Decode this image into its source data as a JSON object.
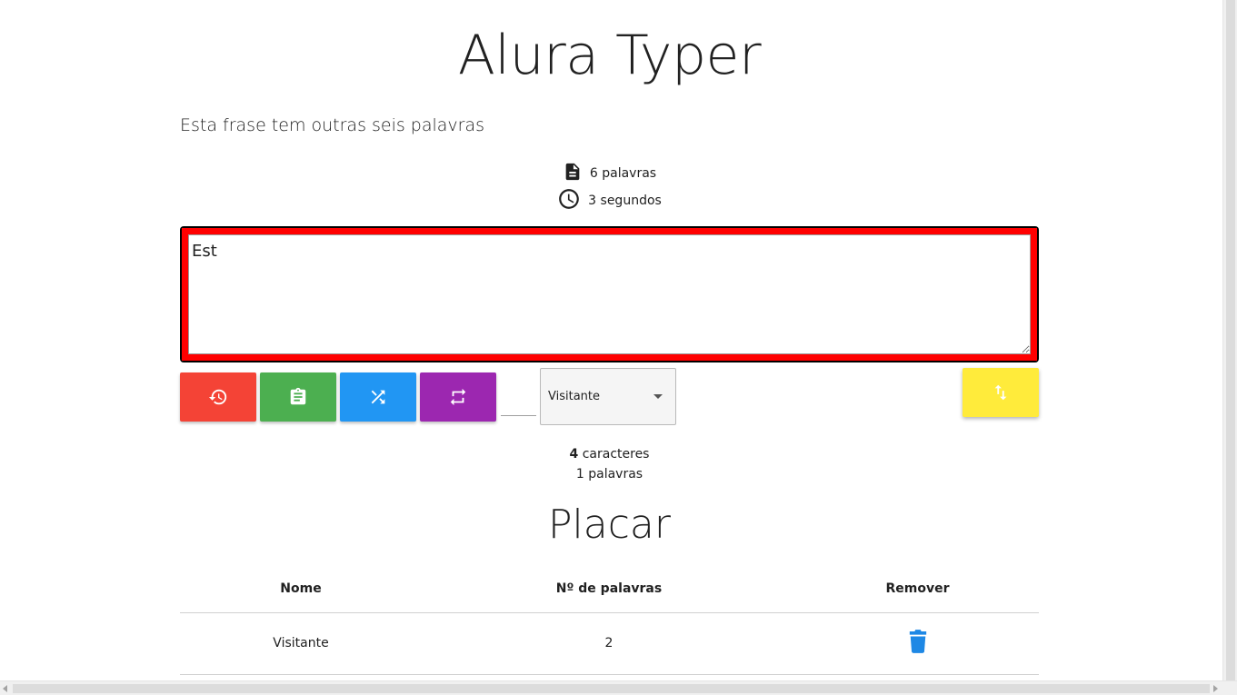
{
  "header": {
    "title": "Alura Typer"
  },
  "phrase": {
    "text": "Esta frase tem outras seis palavras"
  },
  "stats": {
    "words": "6 palavras",
    "time": "3 segundos"
  },
  "typing": {
    "value": "Est"
  },
  "buttons": {
    "restart_icon": "restore-icon",
    "score_icon": "clipboard-icon",
    "shuffle_icon": "shuffle-icon",
    "repeat_icon": "repeat-icon",
    "swap_icon": "swap-vertical-icon"
  },
  "colors": {
    "restart": "#f44336",
    "score": "#4caf50",
    "shuffle": "#2196f3",
    "repeat": "#9c27b0",
    "swap": "#ffeb3b",
    "typing_border_error": "#ff0000",
    "trash": "#1e88e5"
  },
  "user_select": {
    "selected": "Visitante"
  },
  "counters": {
    "chars_count": "4",
    "chars_label": "caracteres",
    "words": "1 palavras"
  },
  "scoreboard": {
    "title": "Placar",
    "columns": [
      "Nome",
      "Nº de palavras",
      "Remover"
    ],
    "rows": [
      {
        "name": "Visitante",
        "words": "2",
        "remove_icon": "trash-icon"
      }
    ]
  }
}
